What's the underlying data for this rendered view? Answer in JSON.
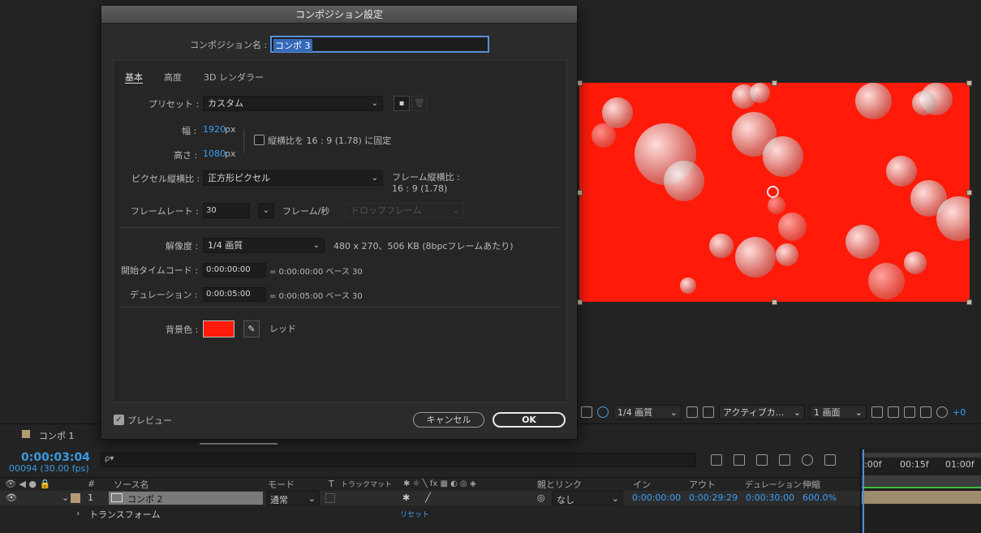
{
  "dialog": {
    "title": "コンポジション設定",
    "comp_name_label": "コンポジション名 :",
    "comp_name_value": "コンポ 3",
    "tabs": [
      "基本",
      "高度",
      "3D レンダラー"
    ],
    "preset_label": "プリセット :",
    "preset_value": "カスタム",
    "width_label": "幅 :",
    "width_value": "1920",
    "width_unit": "px",
    "height_label": "高さ :",
    "height_value": "1080",
    "height_unit": "px",
    "lock_aspect_label": "縦横比を 16 : 9 (1.78) に固定",
    "pixel_aspect_label": "ピクセル縦横比 :",
    "pixel_aspect_value": "正方形ピクセル",
    "frame_aspect_label": "フレーム縦横比 :",
    "frame_aspect_value": "16 : 9 (1.78)",
    "framerate_label": "フレームレート :",
    "framerate_value": "30",
    "framerate_unit": "フレーム/秒",
    "drop_frame_value": "ドロップフレーム",
    "resolution_label": "解像度 :",
    "resolution_value": "1/4 画質",
    "resolution_info": "480 x 270、506 KB (8bpcフレームあたり)",
    "start_tc_label": "開始タイムコード :",
    "start_tc_value": "0:00:00:00",
    "start_tc_info": "= 0:00:00:00  ベース 30",
    "duration_label": "デュレーション :",
    "duration_value": "0:00:05:00",
    "duration_info": "= 0:00:05:00  ベース 30",
    "bg_color_label": "背景色 :",
    "bg_color_hex": "#ff1a0a",
    "bg_color_name": "レッド",
    "preview_label": "プレビュー",
    "cancel_label": "キャンセル",
    "ok_label": "OK"
  },
  "viewer_toolbar": {
    "resolution": "1/4 画質",
    "camera": "アクティブカ...",
    "views": "1 画面",
    "offset": "+0"
  },
  "panel": {
    "comp_tab": "コンポ 1"
  },
  "timeline": {
    "timecode": "0:00:03:04",
    "frames": "00094 (30.00 fps)",
    "search_placeholder": "ρ▾",
    "ruler_marks": [
      ":00f",
      "00:15f",
      "01:00f"
    ],
    "columns": {
      "hash": "#",
      "source": "ソース名",
      "mode": "モード",
      "t": "T",
      "trackmatte": "トラックマット",
      "parent": "親とリンク",
      "in": "イン",
      "out": "アウト",
      "duration": "デュレーション",
      "stretch": "伸縮"
    },
    "layer": {
      "index": "1",
      "name": "コンポ 2",
      "mode": "通常",
      "parent": "なし",
      "in": "0:00:00:00",
      "out": "0:00:29:29",
      "duration": "0:00:30:00",
      "stretch": "600.0%"
    },
    "transform_label": "トランスフォーム",
    "reset_label": "リセット"
  },
  "colors": {
    "accent_blue": "#3a9ef5",
    "canvas_red": "#ff1a0a"
  }
}
